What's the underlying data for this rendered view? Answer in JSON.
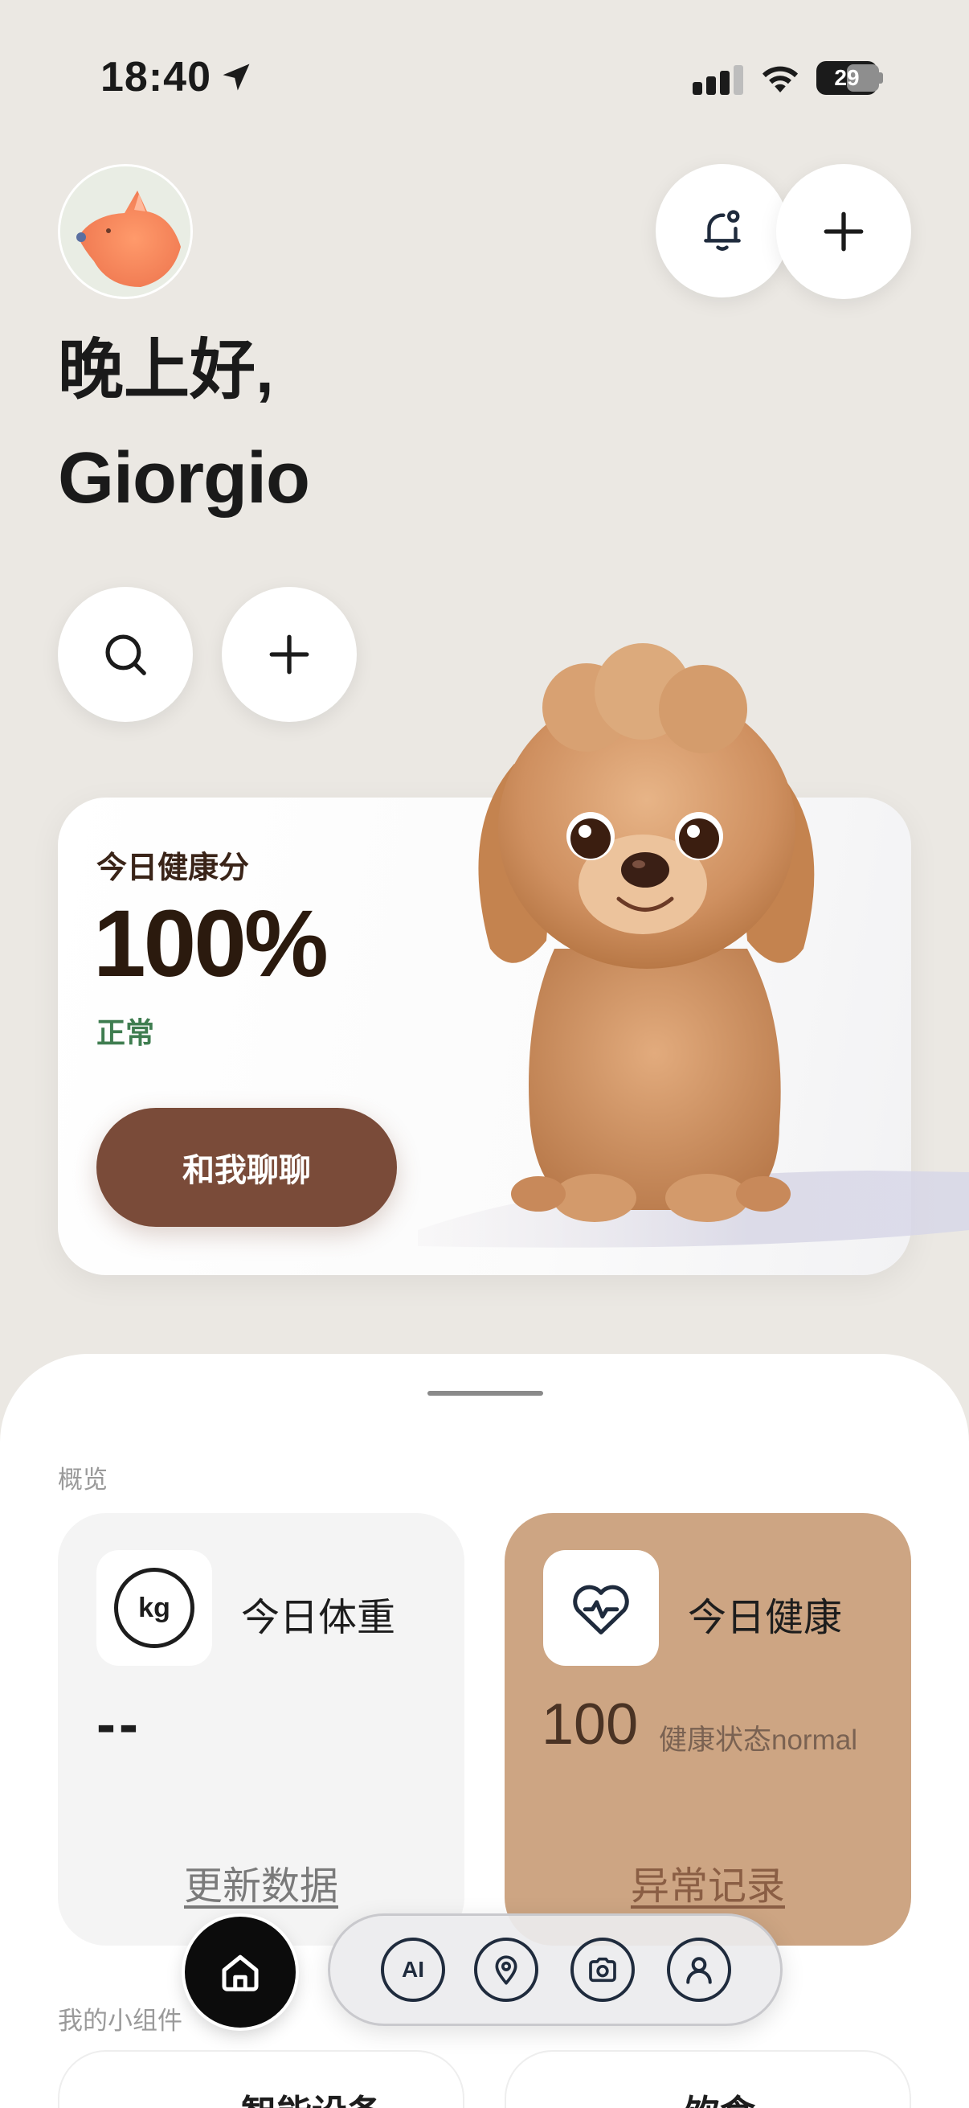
{
  "status_bar": {
    "time": "18:40",
    "battery": "29"
  },
  "header": {
    "greeting": "晚上好,",
    "username": "Giorgio"
  },
  "health_card": {
    "label": "今日健康分",
    "score": "100%",
    "status": "正常",
    "chat_button": "和我聊聊"
  },
  "overview": {
    "section_label": "概览",
    "weight": {
      "icon_text": "kg",
      "title": "今日体重",
      "value": "--",
      "link": "更新数据"
    },
    "health": {
      "title": "今日健康",
      "value": "100",
      "description": "健康状态normal",
      "link": "异常记录"
    }
  },
  "widgets": {
    "section_label": "我的小组件",
    "items": [
      {
        "title": "智能设备"
      },
      {
        "title": "饮食"
      }
    ]
  },
  "tab_bar": {
    "ai_label": "AI",
    "icons": [
      "home-icon",
      "ai-icon",
      "location-icon",
      "camera-icon",
      "profile-icon"
    ]
  },
  "colors": {
    "background": "#ebe8e3",
    "chat_button": "#7a4b39",
    "health_card_accent": "#cda583",
    "status_green": "#3f7d50"
  }
}
